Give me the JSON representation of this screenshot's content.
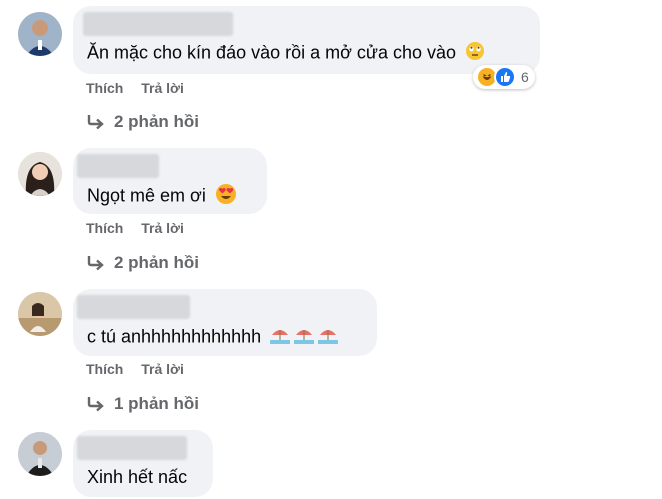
{
  "comments": [
    {
      "text": "Ăn mặc cho kín đáo vào rồi a mở cửa cho vào",
      "emoji": "rolling-eyes-emoji",
      "actions": {
        "like": "Thích",
        "reply": "Trả lời"
      },
      "replies": "2 phản hồi",
      "reactions": {
        "count": "6",
        "icons": [
          "haha-reaction-icon",
          "like-reaction-icon"
        ]
      }
    },
    {
      "text": "Ngọt mê em ơi",
      "emoji": "heart-eyes-emoji",
      "actions": {
        "like": "Thích",
        "reply": "Trả lời"
      },
      "replies": "2 phản hồi"
    },
    {
      "text": "c tú anhhhhhhhhhhhh",
      "emoji": "umbrella-beach-emoji",
      "actions": {
        "like": "Thích",
        "reply": "Trả lời"
      },
      "replies": "1 phản hồi"
    },
    {
      "text": "Xinh hết nấc"
    }
  ],
  "colors": {
    "bubble": "#f0f2f5",
    "secondary_text": "#65676b",
    "like_blue": "#1877f2",
    "haha_yellow": "#f7b125"
  }
}
